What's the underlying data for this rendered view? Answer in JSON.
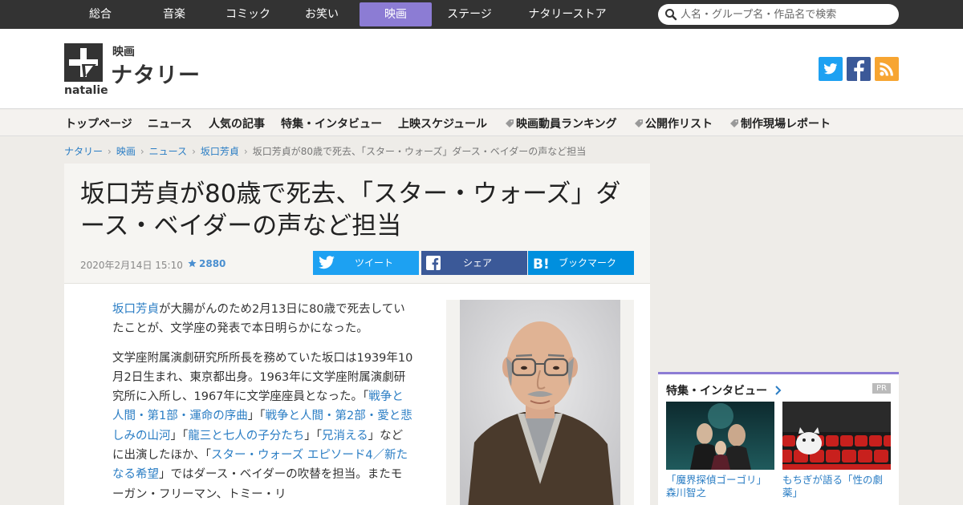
{
  "topnav": {
    "items": [
      {
        "label": "総合",
        "active": false
      },
      {
        "label": "音楽",
        "active": false
      },
      {
        "label": "コミック",
        "active": false
      },
      {
        "label": "お笑い",
        "active": false
      },
      {
        "label": "映画",
        "active": true
      },
      {
        "label": "ステージ",
        "active": false
      },
      {
        "label": "ナタリーストア",
        "active": false
      }
    ],
    "search_placeholder": "人名・グループ名・作品名で検索"
  },
  "header": {
    "logo_small": "映画",
    "logo_big": "ナタリー",
    "logo_sub": "natalie",
    "social_icons": [
      "twitter-icon",
      "facebook-icon",
      "rss-icon"
    ]
  },
  "colors": {
    "accent": "#8c7cd4",
    "link": "#2a7dc4",
    "twitter": "#1da1f2",
    "facebook": "#3b5998",
    "hatena": "#008fde",
    "rss": "#f7a531"
  },
  "subnav": {
    "items": [
      {
        "label": "トップページ",
        "tag": false
      },
      {
        "label": "ニュース",
        "tag": false
      },
      {
        "label": "人気の記事",
        "tag": false
      },
      {
        "label": "特集・インタビュー",
        "tag": false
      },
      {
        "label": "上映スケジュール",
        "tag": false
      },
      {
        "label": "映画動員ランキング",
        "tag": true
      },
      {
        "label": "公開作リスト",
        "tag": true
      },
      {
        "label": "制作現場レポート",
        "tag": true
      }
    ]
  },
  "breadcrumb": {
    "links": [
      "ナタリー",
      "映画",
      "ニュース",
      "坂口芳貞"
    ],
    "current": "坂口芳貞が80歳で死去、「スター・ウォーズ」ダース・ベイダーの声など担当"
  },
  "article": {
    "title": "坂口芳貞が80歳で死去、「スター・ウォーズ」ダース・ベイダーの声など担当",
    "date": "2020年2月14日 15:10",
    "stars": "2880",
    "share": {
      "tweet": "ツイート",
      "facebook": "シェア",
      "hatena": "ブックマーク"
    },
    "p1_link": "坂口芳貞",
    "p1_text": "が大腸がんのため2月13日に80歳で死去していたことが、文学座の発表で本日明らかになった。",
    "p2_a": "文学座附属演劇研究所所長を務めていた坂口は1939年10月2日生まれ、東京都出身。1963年に文学座附属演劇研究所に入所し、1967年に文学座座員となった。「",
    "p2_link1": "戦争と人間・第1部・運命の序曲",
    "p2_b": "」「",
    "p2_link2": "戦争と人間・第2部・愛と悲しみの山河",
    "p2_c": "」「",
    "p2_link3": "龍三と七人の子分たち",
    "p2_d": "」「",
    "p2_link4": "兄消える",
    "p2_e": "」などに出演したほか、「",
    "p2_link5": "スター・ウォーズ エピソード4／新たなる希望",
    "p2_f": "」ではダース・ベイダーの吹替を担当。またモーガン・フリーマン、トミー・リ"
  },
  "feature": {
    "title": "特集・インタビュー",
    "pr": "PR",
    "items": [
      {
        "caption": "「魔界探偵ゴーゴリ」森川智之"
      },
      {
        "caption": "もちぎが語る「性の劇薬」"
      }
    ]
  }
}
